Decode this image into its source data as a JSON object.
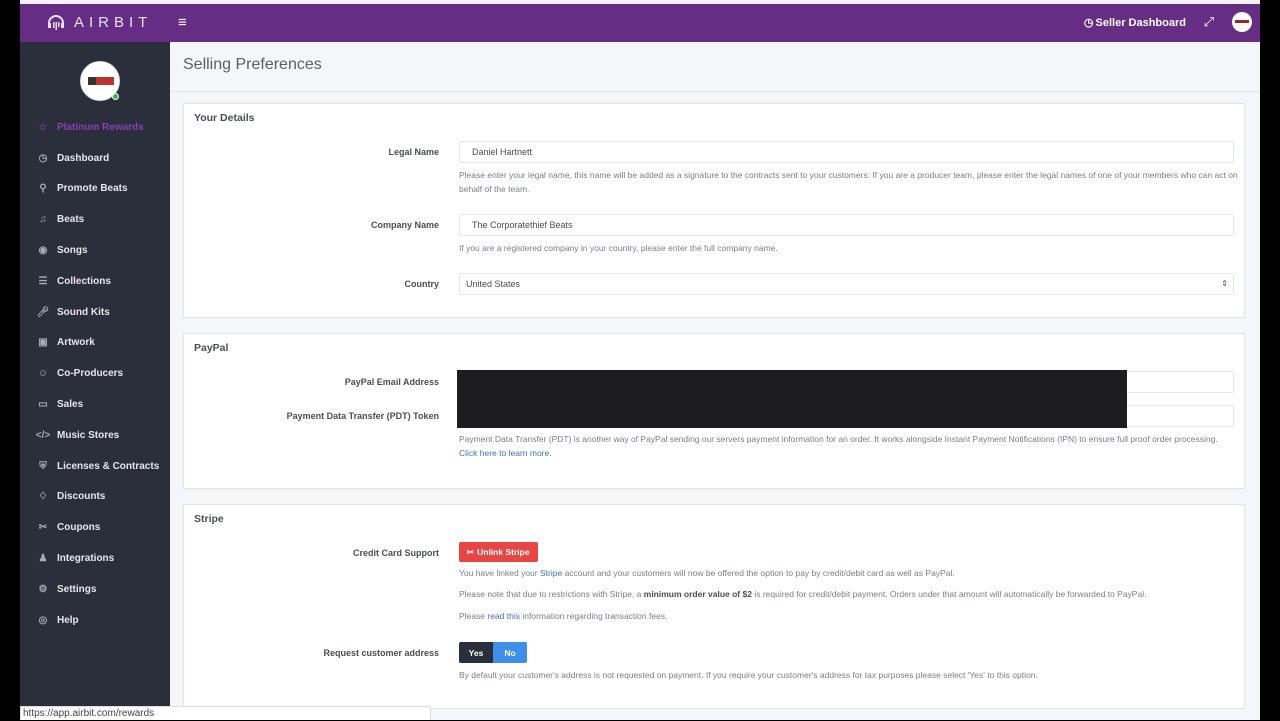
{
  "topbar": {
    "brand": "AIRBIT",
    "seller_dashboard": "Seller Dashboard",
    "colors": {
      "brand_purple": "#652d84",
      "sidebar_bg": "#2b2e3b",
      "danger": "#e84545",
      "primary": "#3f8fe8"
    }
  },
  "sidebar": {
    "items": [
      {
        "label": "Platinum Rewards",
        "icon": "star-icon"
      },
      {
        "label": "Dashboard",
        "icon": "gauge-icon"
      },
      {
        "label": "Promote Beats",
        "icon": "rocket-icon"
      },
      {
        "label": "Beats",
        "icon": "music-note-icon"
      },
      {
        "label": "Songs",
        "icon": "headphones-icon"
      },
      {
        "label": "Collections",
        "icon": "layers-icon"
      },
      {
        "label": "Sound Kits",
        "icon": "microphone-icon"
      },
      {
        "label": "Artwork",
        "icon": "image-icon"
      },
      {
        "label": "Co-Producers",
        "icon": "users-icon"
      },
      {
        "label": "Sales",
        "icon": "wallet-icon"
      },
      {
        "label": "Music Stores",
        "icon": "code-icon"
      },
      {
        "label": "Licenses & Contracts",
        "icon": "shield-icon"
      },
      {
        "label": "Discounts",
        "icon": "tag-icon"
      },
      {
        "label": "Coupons",
        "icon": "scissors-icon"
      },
      {
        "label": "Integrations",
        "icon": "plug-icon"
      },
      {
        "label": "Settings",
        "icon": "gear-icon"
      },
      {
        "label": "Help",
        "icon": "lifebuoy-icon"
      }
    ]
  },
  "page": {
    "title": "Selling Preferences"
  },
  "details": {
    "heading": "Your Details",
    "legal_name_label": "Legal Name",
    "legal_name_value": "Daniel Hartnett",
    "legal_name_help": "Please enter your legal name, this name will be added as a signature to the contracts sent to your customers. If you are a producer team, please enter the legal names of one of your members who can act on behalf of the team.",
    "company_label": "Company Name",
    "company_value": "The Corporatethief Beats",
    "company_help": "If you are a registered company in your country, please enter the full company name.",
    "country_label": "Country",
    "country_value": "United States"
  },
  "paypal": {
    "heading": "PayPal",
    "email_label": "PayPal Email Address",
    "pdt_label": "Payment Data Transfer (PDT) Token",
    "help": "Payment Data Transfer (PDT) is another way of PayPal sending our servers payment information for an order. It works alongside Instant Payment Notifications (IPN) to ensure full proof order processing.",
    "help_link": "Click here to learn more."
  },
  "stripe": {
    "heading": "Stripe",
    "cc_label": "Credit Card Support",
    "unlink_button": "Unlink Stripe",
    "linked_pre": "You have linked your",
    "linked_link": "Stripe",
    "linked_post": "account and your customers will now be offered the option to pay by credit/debit card as well as PayPal.",
    "note_pre": "Please note that due to restrictions with Stripe, a",
    "note_bold": "minimum order value of $2",
    "note_post": "is required for credit/debit payment. Orders under that amount will automatically be forwarded to PayPal.",
    "fees_pre": "Please",
    "fees_link": "read this",
    "fees_post": "information regarding transaction fees.",
    "address_label": "Request customer address",
    "yes": "Yes",
    "no": "No",
    "address_help": "By default your customer's address is not requested on payment. If you require your customer's address for tax purposes please select 'Yes' to this option."
  },
  "statusbar": {
    "url": "https://app.airbit.com/rewards"
  }
}
